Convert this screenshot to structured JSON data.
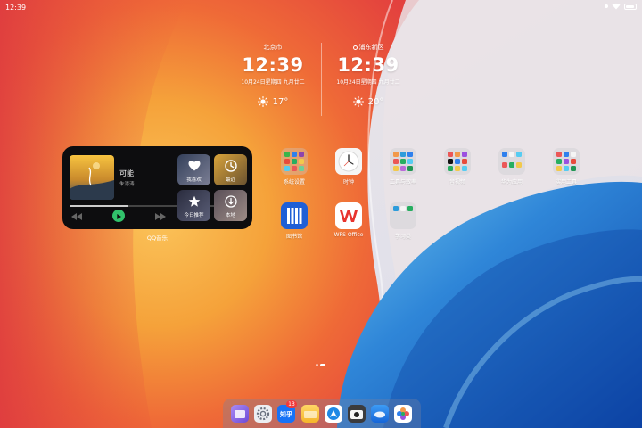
{
  "status_bar": {
    "time": "12:39",
    "wifi_icon": "wifi-icon",
    "battery_icon": "battery-icon"
  },
  "clocks": [
    {
      "city": "北京市",
      "time": "12:39",
      "date": "10月24日星期四 九月廿二",
      "temperature": "17°",
      "weather_icon": "sun-icon",
      "location_icon": ""
    },
    {
      "city": "浦东新区",
      "time": "12:39",
      "date": "10月24日星期四 九月廿二",
      "temperature": "20°",
      "weather_icon": "sun-icon",
      "location_icon": "location-icon"
    }
  ],
  "music_widget": {
    "song_title": "可能",
    "artist": "朱添涛",
    "progress": 0.36,
    "caption": "QQ音乐",
    "tiles": [
      {
        "label": "我喜欢",
        "icon": "heart-icon"
      },
      {
        "label": "最近",
        "icon": "clock-icon"
      },
      {
        "label": "今日推荐",
        "icon": "star-icon"
      },
      {
        "label": "本地",
        "icon": "download-icon"
      }
    ],
    "album_text": "可能"
  },
  "apps": [
    {
      "label": "系统设置",
      "icon": "settings-folder-icon"
    },
    {
      "label": "时钟",
      "icon": "clock-icon"
    },
    {
      "label": "工具与效率",
      "icon": "tools-folder-icon"
    },
    {
      "label": "音视频",
      "icon": "media-folder-icon"
    },
    {
      "label": "华为应用",
      "icon": "huawei-apps-folder-icon"
    },
    {
      "label": "实用工具",
      "icon": "utilities-folder-icon"
    },
    {
      "label": "图书馆",
      "icon": "library-icon"
    },
    {
      "label": "WPS Office",
      "icon": "wps-office-icon"
    },
    {
      "label": "学习类",
      "icon": "study-folder-icon"
    }
  ],
  "dock": {
    "apps": [
      "folder-app-icon",
      "settings-icon",
      "zhihu-icon",
      "file-manager-icon",
      "browser-icon",
      "camera-icon",
      "cloud-drive-icon",
      "gallery-icon"
    ],
    "zhihu_label": "知乎",
    "zhihu_badge": "13"
  },
  "colors": {
    "wallpaper_orange": "#f39a2c",
    "wallpaper_red": "#e4453d",
    "wallpaper_blue": "#1c6fd1",
    "play_green": "#31c26b"
  }
}
